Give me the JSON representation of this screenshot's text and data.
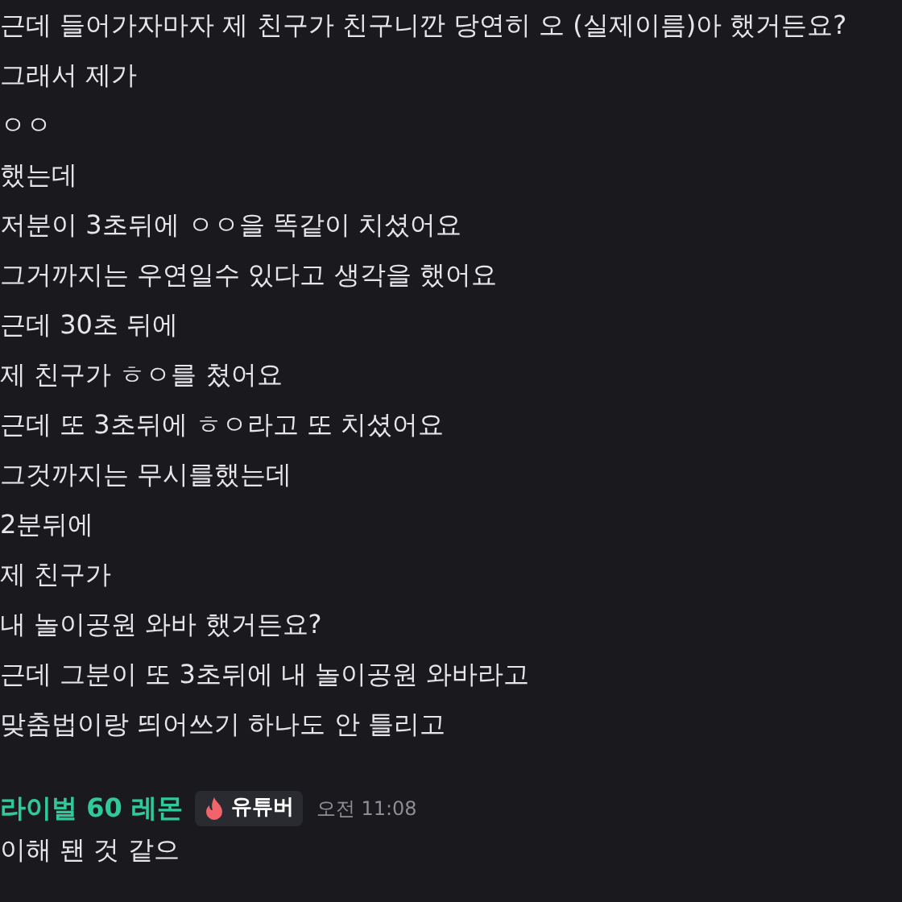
{
  "lines": [
    "근데 들어가자마자 제 친구가 친구니깐 당연히 오 (실제이름)아 했거든요?",
    "그래서 제가",
    "ㅇㅇ",
    "했는데",
    "저분이 3초뒤에 ㅇㅇ을 똑같이 치셨어요",
    "그거까지는 우연일수 있다고 생각을 했어요",
    "근데 30초 뒤에",
    "제 친구가 ㅎㅇ를 쳤어요",
    "근데 또 3초뒤에 ㅎㅇ라고 또 치셨어요",
    "그것까지는 무시를했는데",
    "2분뒤에",
    "제 친구가",
    "내 놀이공원 와바 했거든요?",
    "근데 그분이 또 3초뒤에 내 놀이공원 와바라고",
    "맞춤법이랑 띄어쓰기 하나도 안 틀리고"
  ],
  "next_message": {
    "author": "라이벌 60 레몬",
    "badge": "유튜버",
    "time": "오전 11:08",
    "text": "이해 됀 것 같으"
  }
}
